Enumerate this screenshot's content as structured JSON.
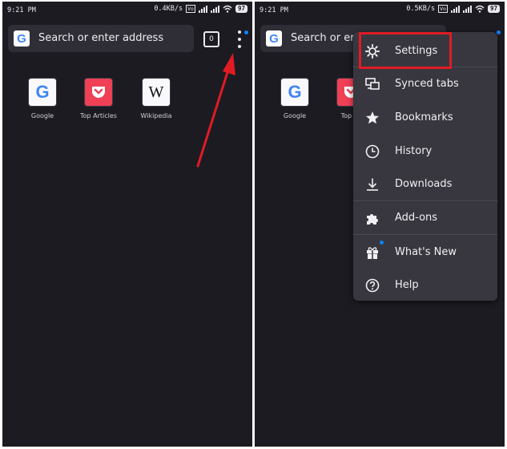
{
  "status_left": {
    "time": "9:21 PM",
    "net_speed": "0.4KB/s",
    "volte": "Vo",
    "network": "4G",
    "battery": "97"
  },
  "status_right": {
    "time": "9:21 PM",
    "net_speed": "0.5KB/s",
    "volte": "Vo",
    "network": "4G",
    "battery": "97"
  },
  "left_screen": {
    "url_placeholder": "Search or enter address",
    "tab_count": "0",
    "top_sites": [
      {
        "label": "Google",
        "icon": "google-icon"
      },
      {
        "label": "Top Articles",
        "icon": "pocket-icon"
      },
      {
        "label": "Wikipedia",
        "icon": "wikipedia-icon"
      }
    ]
  },
  "right_screen": {
    "url_placeholder": "Search or en",
    "top_sites": [
      {
        "label": "Google",
        "icon": "google-icon"
      },
      {
        "label": "Top Ar",
        "icon": "pocket-icon"
      }
    ],
    "menu": [
      {
        "label": "Settings",
        "icon": "gear-icon"
      },
      {
        "label": "Synced tabs",
        "icon": "synced-tabs-icon"
      },
      {
        "label": "Bookmarks",
        "icon": "star-icon"
      },
      {
        "label": "History",
        "icon": "clock-icon"
      },
      {
        "label": "Downloads",
        "icon": "download-icon"
      },
      {
        "label": "Add-ons",
        "icon": "puzzle-icon"
      },
      {
        "label": "What's New",
        "icon": "gift-icon"
      },
      {
        "label": "Help",
        "icon": "help-icon"
      }
    ]
  },
  "colors": {
    "background": "#1c1b22",
    "urlbar": "#2f2e37",
    "menu": "#38373f",
    "accent_dot": "#0a84ff",
    "annotation_red": "#e01b24",
    "pocket": "#ef4056"
  }
}
